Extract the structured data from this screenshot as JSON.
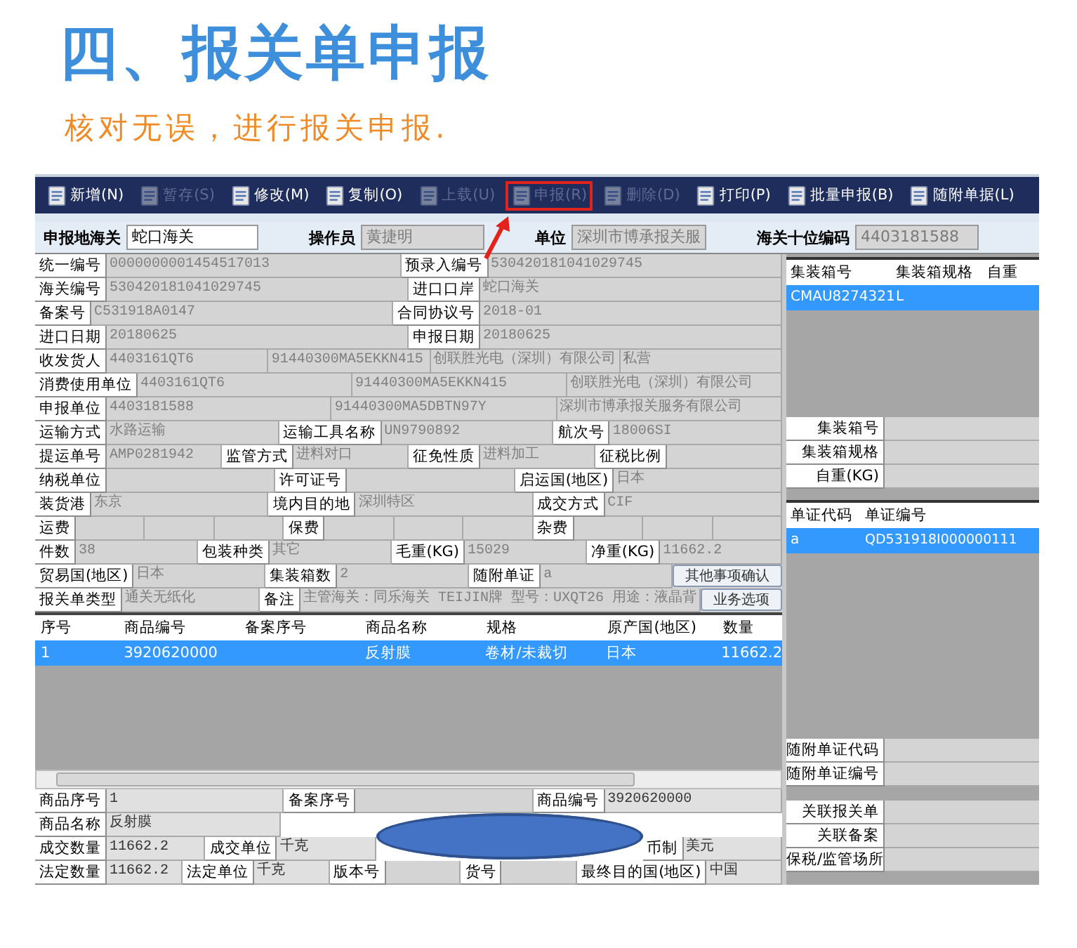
{
  "heading": {
    "title": "四、报关单申报",
    "subtitle": "核对无误，进行报关申报."
  },
  "toolbar": [
    {
      "label": "新增(N)",
      "disabled": false,
      "highlighted": false
    },
    {
      "label": "暂存(S)",
      "disabled": true,
      "highlighted": false
    },
    {
      "label": "修改(M)",
      "disabled": false,
      "highlighted": false
    },
    {
      "label": "复制(O)",
      "disabled": false,
      "highlighted": false
    },
    {
      "label": "上载(U)",
      "disabled": true,
      "highlighted": false
    },
    {
      "label": "申报(R)",
      "disabled": true,
      "highlighted": true
    },
    {
      "label": "删除(D)",
      "disabled": true,
      "highlighted": false
    },
    {
      "label": "打印(P)",
      "disabled": false,
      "highlighted": false
    },
    {
      "label": "批量申报(B)",
      "disabled": false,
      "highlighted": false
    },
    {
      "label": "随附单据(L)",
      "disabled": false,
      "highlighted": false
    }
  ],
  "header": [
    {
      "label": "申报地海关",
      "value": "蛇口海关",
      "readonly": false
    },
    {
      "label": "操作员",
      "value": "黄捷明",
      "readonly": true
    },
    {
      "label": "单位",
      "value": "深圳市博承报关服",
      "readonly": true
    },
    {
      "label": "海关十位编码",
      "value": "4403181588",
      "readonly": true
    }
  ],
  "form": {
    "lines": [
      {
        "items": [
          {
            "kind": "label",
            "text": "统一编号"
          },
          {
            "kind": "value",
            "text": "0000000001454517013"
          },
          {
            "kind": "label",
            "text": "预录入编号"
          },
          {
            "kind": "value",
            "text": "530420181041029745"
          }
        ]
      },
      {
        "items": [
          {
            "kind": "label",
            "text": "海关编号"
          },
          {
            "kind": "value",
            "text": "530420181041029745"
          },
          {
            "kind": "label",
            "text": "进口口岸"
          },
          {
            "kind": "value",
            "text": "蛇口海关"
          }
        ]
      },
      {
        "items": [
          {
            "kind": "label",
            "text": "备案号"
          },
          {
            "kind": "value",
            "text": "C531918A0147"
          },
          {
            "kind": "label",
            "text": "合同协议号"
          },
          {
            "kind": "value",
            "text": "2018-01"
          }
        ]
      },
      {
        "items": [
          {
            "kind": "label",
            "text": "进口日期"
          },
          {
            "kind": "value",
            "text": "20180625"
          },
          {
            "kind": "label",
            "text": "申报日期"
          },
          {
            "kind": "value",
            "text": "20180625"
          }
        ]
      },
      {
        "items": [
          {
            "kind": "label",
            "text": "收发货人"
          },
          {
            "kind": "value",
            "text": "4403161QT6"
          },
          {
            "kind": "value",
            "text": "91440300MA5EKKN415"
          },
          {
            "kind": "value",
            "text": "创联胜光电（深圳）有限公司"
          },
          {
            "kind": "value",
            "text": "私营"
          }
        ]
      },
      {
        "items": [
          {
            "kind": "label",
            "text": "消费使用单位"
          },
          {
            "kind": "value",
            "text": "4403161QT6"
          },
          {
            "kind": "value",
            "text": "91440300MA5EKKN415"
          },
          {
            "kind": "value",
            "text": "创联胜光电（深圳）有限公司"
          }
        ]
      },
      {
        "items": [
          {
            "kind": "label",
            "text": "申报单位"
          },
          {
            "kind": "value",
            "text": "4403181588"
          },
          {
            "kind": "value",
            "text": "91440300MA5DBTN97Y"
          },
          {
            "kind": "value",
            "text": "深圳市博承报关服务有限公司"
          }
        ]
      },
      {
        "items": [
          {
            "kind": "label",
            "text": "运输方式"
          },
          {
            "kind": "value",
            "text": "水路运输"
          },
          {
            "kind": "label",
            "text": "运输工具名称"
          },
          {
            "kind": "value",
            "text": "UN9790892"
          },
          {
            "kind": "label",
            "text": "航次号"
          },
          {
            "kind": "value",
            "text": "18006SI"
          }
        ]
      },
      {
        "items": [
          {
            "kind": "label",
            "text": "提运单号"
          },
          {
            "kind": "value",
            "text": "AMP0281942"
          },
          {
            "kind": "label",
            "text": "监管方式"
          },
          {
            "kind": "value",
            "text": "进料对口"
          },
          {
            "kind": "label",
            "text": "征免性质"
          },
          {
            "kind": "value",
            "text": "进料加工"
          },
          {
            "kind": "label",
            "text": "征税比例"
          },
          {
            "kind": "blank"
          }
        ]
      },
      {
        "items": [
          {
            "kind": "label",
            "text": "纳税单位"
          },
          {
            "kind": "blank"
          },
          {
            "kind": "label",
            "text": "许可证号"
          },
          {
            "kind": "blank"
          },
          {
            "kind": "label",
            "text": "启运国(地区)"
          },
          {
            "kind": "value",
            "text": "日本"
          }
        ]
      },
      {
        "items": [
          {
            "kind": "label",
            "text": "装货港"
          },
          {
            "kind": "value",
            "text": "东京"
          },
          {
            "kind": "label",
            "text": "境内目的地"
          },
          {
            "kind": "value",
            "text": "深圳特区"
          },
          {
            "kind": "label",
            "text": "成交方式"
          },
          {
            "kind": "value",
            "text": "CIF"
          }
        ]
      },
      {
        "items": [
          {
            "kind": "label",
            "text": "运费"
          },
          {
            "kind": "blank"
          },
          {
            "kind": "blank"
          },
          {
            "kind": "blank"
          },
          {
            "kind": "label",
            "text": "保费"
          },
          {
            "kind": "blank"
          },
          {
            "kind": "blank"
          },
          {
            "kind": "blank"
          },
          {
            "kind": "label",
            "text": "杂费"
          },
          {
            "kind": "blank"
          },
          {
            "kind": "blank"
          },
          {
            "kind": "blank"
          }
        ]
      },
      {
        "items": [
          {
            "kind": "label",
            "text": "件数"
          },
          {
            "kind": "value",
            "text": "38"
          },
          {
            "kind": "label",
            "text": "包装种类"
          },
          {
            "kind": "value",
            "text": "其它"
          },
          {
            "kind": "label",
            "text": "毛重(KG)"
          },
          {
            "kind": "value",
            "text": "15029"
          },
          {
            "kind": "label",
            "text": "净重(KG)"
          },
          {
            "kind": "value",
            "text": "11662.2"
          }
        ]
      },
      {
        "items": [
          {
            "kind": "label",
            "text": "贸易国(地区)"
          },
          {
            "kind": "value",
            "text": "日本"
          },
          {
            "kind": "label",
            "text": "集装箱数"
          },
          {
            "kind": "value",
            "text": "2"
          },
          {
            "kind": "label",
            "text": "随附单证"
          },
          {
            "kind": "value",
            "text": "a"
          },
          {
            "kind": "action",
            "text": "其他事项确认"
          }
        ]
      },
      {
        "items": [
          {
            "kind": "label",
            "text": "报关单类型"
          },
          {
            "kind": "value",
            "text": "通关无纸化"
          },
          {
            "kind": "label",
            "text": "备注"
          },
          {
            "kind": "value",
            "text": "主管海关：同乐海关 TEIJIN牌 型号：UXQT26 用途：液晶背"
          },
          {
            "kind": "action",
            "text": "业务选项"
          }
        ]
      }
    ]
  },
  "goods_table": {
    "columns": [
      "序号",
      "商品编号",
      "备案序号",
      "商品名称",
      "规格",
      "原产国(地区)",
      "数量"
    ],
    "rows": [
      {
        "selected": true,
        "cells": [
          "1",
          "3920620000",
          "",
          "反射膜",
          "卷材/未裁切",
          "日本",
          "11662.2"
        ]
      }
    ]
  },
  "goods_detail": {
    "lines": [
      {
        "items": [
          {
            "kind": "label",
            "text": "商品序号"
          },
          {
            "kind": "value",
            "text": "1"
          },
          {
            "kind": "label",
            "text": "备案序号"
          },
          {
            "kind": "blank"
          },
          {
            "kind": "label",
            "text": "商品编号"
          },
          {
            "kind": "value",
            "text": "3920620000"
          }
        ]
      },
      {
        "items": [
          {
            "kind": "label",
            "text": "商品名称"
          },
          {
            "kind": "value",
            "text": "反射膜"
          },
          {
            "kind": "covered"
          }
        ]
      },
      {
        "items": [
          {
            "kind": "label",
            "text": "成交数量"
          },
          {
            "kind": "value",
            "text": "11662.2"
          },
          {
            "kind": "label",
            "text": "成交单位"
          },
          {
            "kind": "value",
            "text": "千克"
          },
          {
            "kind": "redaction"
          },
          {
            "kind": "label",
            "text": "币制"
          },
          {
            "kind": "value",
            "text": "美元"
          }
        ]
      },
      {
        "items": [
          {
            "kind": "label",
            "text": "法定数量"
          },
          {
            "kind": "value",
            "text": "11662.2"
          },
          {
            "kind": "label",
            "text": "法定单位"
          },
          {
            "kind": "value",
            "text": "千克"
          },
          {
            "kind": "label",
            "text": "版本号"
          },
          {
            "kind": "blank"
          },
          {
            "kind": "label",
            "text": "货号"
          },
          {
            "kind": "blank"
          },
          {
            "kind": "label",
            "text": "最终目的国(地区)"
          },
          {
            "kind": "value",
            "text": "中国"
          }
        ]
      }
    ]
  },
  "container_table": {
    "columns": [
      "集装箱号",
      "集装箱规格",
      "自重"
    ],
    "rows": [
      {
        "selected": true,
        "cells": [
          "CMAU8274321",
          "L",
          ""
        ]
      }
    ]
  },
  "container_fields": [
    {
      "label": "集装箱号"
    },
    {
      "label": "集装箱规格"
    },
    {
      "label": "自重(KG)"
    }
  ],
  "document_table": {
    "columns": [
      "单证代码",
      "单证编号"
    ],
    "rows": [
      {
        "selected": true,
        "cells": [
          "a",
          "QD531918I000000111"
        ]
      }
    ]
  },
  "document_fields": [
    {
      "label": "随附单证代码"
    },
    {
      "label": "随附单证编号"
    }
  ],
  "related_fields": [
    {
      "label": "关联报关单"
    },
    {
      "label": "关联备案"
    },
    {
      "label": "保税/监管场所"
    }
  ]
}
